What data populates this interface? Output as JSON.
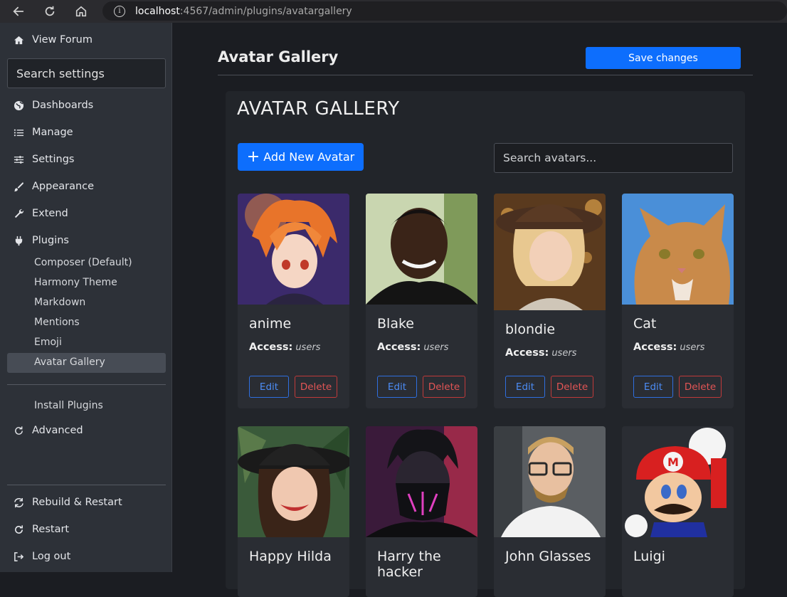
{
  "browser": {
    "url_host": "localhost",
    "url_path": ":4567/admin/plugins/avatargallery"
  },
  "sidebar": {
    "view_forum": "View Forum",
    "search_placeholder": "Search settings",
    "items": [
      {
        "label": "Dashboards",
        "icon": "globe-icon"
      },
      {
        "label": "Manage",
        "icon": "list-icon"
      },
      {
        "label": "Settings",
        "icon": "sliders-icon"
      },
      {
        "label": "Appearance",
        "icon": "brush-icon"
      },
      {
        "label": "Extend",
        "icon": "wrench-icon"
      },
      {
        "label": "Plugins",
        "icon": "plug-icon"
      }
    ],
    "plugins_sub": [
      "Composer (Default)",
      "Harmony Theme",
      "Markdown",
      "Mentions",
      "Emoji",
      "Avatar Gallery"
    ],
    "install_plugins": "Install Plugins",
    "advanced": "Advanced",
    "bottom": [
      {
        "label": "Rebuild & Restart",
        "icon": "rebuild-icon"
      },
      {
        "label": "Restart",
        "icon": "restart-icon"
      },
      {
        "label": "Log out",
        "icon": "logout-icon"
      }
    ]
  },
  "main": {
    "page_title": "Avatar Gallery",
    "save_label": "Save changes",
    "panel_title": "AVATAR GALLERY",
    "add_label": "Add New Avatar",
    "search_placeholder": "Search avatars...",
    "access_label": "Access:",
    "edit_label": "Edit",
    "delete_label": "Delete",
    "avatars": [
      {
        "name": "anime",
        "access": "users"
      },
      {
        "name": "Blake",
        "access": "users"
      },
      {
        "name": "blondie",
        "access": "users"
      },
      {
        "name": "Cat",
        "access": "users"
      },
      {
        "name": "Happy Hilda"
      },
      {
        "name": "Harry the hacker"
      },
      {
        "name": "John Glasses"
      },
      {
        "name": "Luigi"
      }
    ]
  },
  "colors": {
    "accent": "#0d6efd",
    "danger": "#dc3545",
    "sidebar_bg": "#2d3138",
    "main_bg": "#1b1d22"
  }
}
